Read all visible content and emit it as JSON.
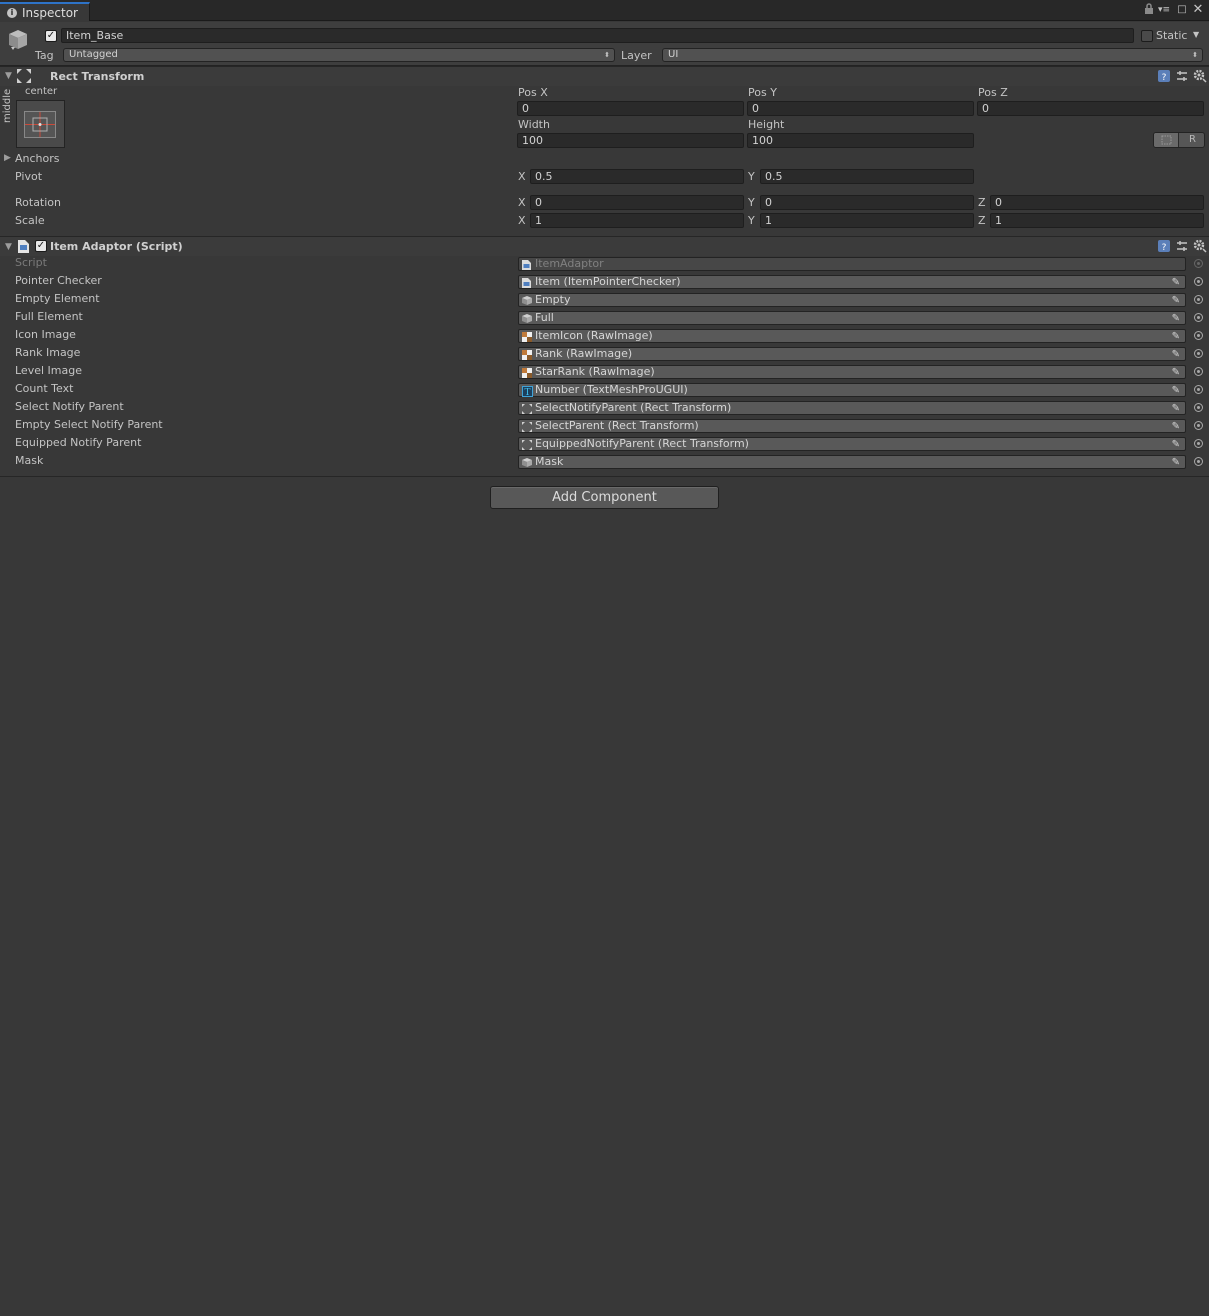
{
  "window": {
    "tab_label": "Inspector",
    "tab_icon": "info-icon"
  },
  "header": {
    "object_active": true,
    "object_name": "Item_Base",
    "static_label": "Static",
    "static_checked": false,
    "tag_label": "Tag",
    "tag_value": "Untagged",
    "layer_label": "Layer",
    "layer_value": "UI"
  },
  "rect_transform": {
    "title": "Rect Transform",
    "anchor_h": "center",
    "anchor_v": "middle",
    "posx_label": "Pos X",
    "posy_label": "Pos Y",
    "posz_label": "Pos Z",
    "posx": "0",
    "posy": "0",
    "posz": "0",
    "width_label": "Width",
    "height_label": "Height",
    "width": "100",
    "height": "100",
    "r_label": "R",
    "anchors_label": "Anchors",
    "pivot_label": "Pivot",
    "pivot_x": "0.5",
    "pivot_y": "0.5",
    "rotation_label": "Rotation",
    "rot_x": "0",
    "rot_y": "0",
    "rot_z": "0",
    "scale_label": "Scale",
    "scale_x": "1",
    "scale_y": "1",
    "scale_z": "1",
    "axis_x": "X",
    "axis_y": "Y",
    "axis_z": "Z"
  },
  "item_adaptor": {
    "title": "Item Adaptor (Script)",
    "enabled": true,
    "fields": [
      {
        "label": "Script",
        "value": "ItemAdaptor",
        "icon": "script-icon"
      },
      {
        "label": "Pointer Checker",
        "value": "Item (ItemPointerChecker)",
        "icon": "script-icon"
      },
      {
        "label": "Empty Element",
        "value": "Empty",
        "icon": "gameobject-icon"
      },
      {
        "label": "Full Element",
        "value": "Full",
        "icon": "gameobject-icon"
      },
      {
        "label": "Icon Image",
        "value": "ItemIcon (RawImage)",
        "icon": "rawimage-icon"
      },
      {
        "label": "Rank Image",
        "value": "Rank (RawImage)",
        "icon": "rawimage-icon"
      },
      {
        "label": "Level Image",
        "value": "StarRank (RawImage)",
        "icon": "rawimage-icon"
      },
      {
        "label": "Count Text",
        "value": "Number (TextMeshProUGUI)",
        "icon": "textmeshpro-icon"
      },
      {
        "label": "Select Notify Parent",
        "value": "SelectNotifyParent (Rect Transform)",
        "icon": "recttransform-icon"
      },
      {
        "label": "Empty Select Notify Parent",
        "value": "SelectParent (Rect Transform)",
        "icon": "recttransform-icon"
      },
      {
        "label": "Equipped Notify Parent",
        "value": "EquippedNotifyParent (Rect Transform)",
        "icon": "recttransform-icon"
      },
      {
        "label": "Mask",
        "value": "Mask",
        "icon": "gameobject-icon"
      }
    ]
  },
  "add_component_label": "Add Component"
}
